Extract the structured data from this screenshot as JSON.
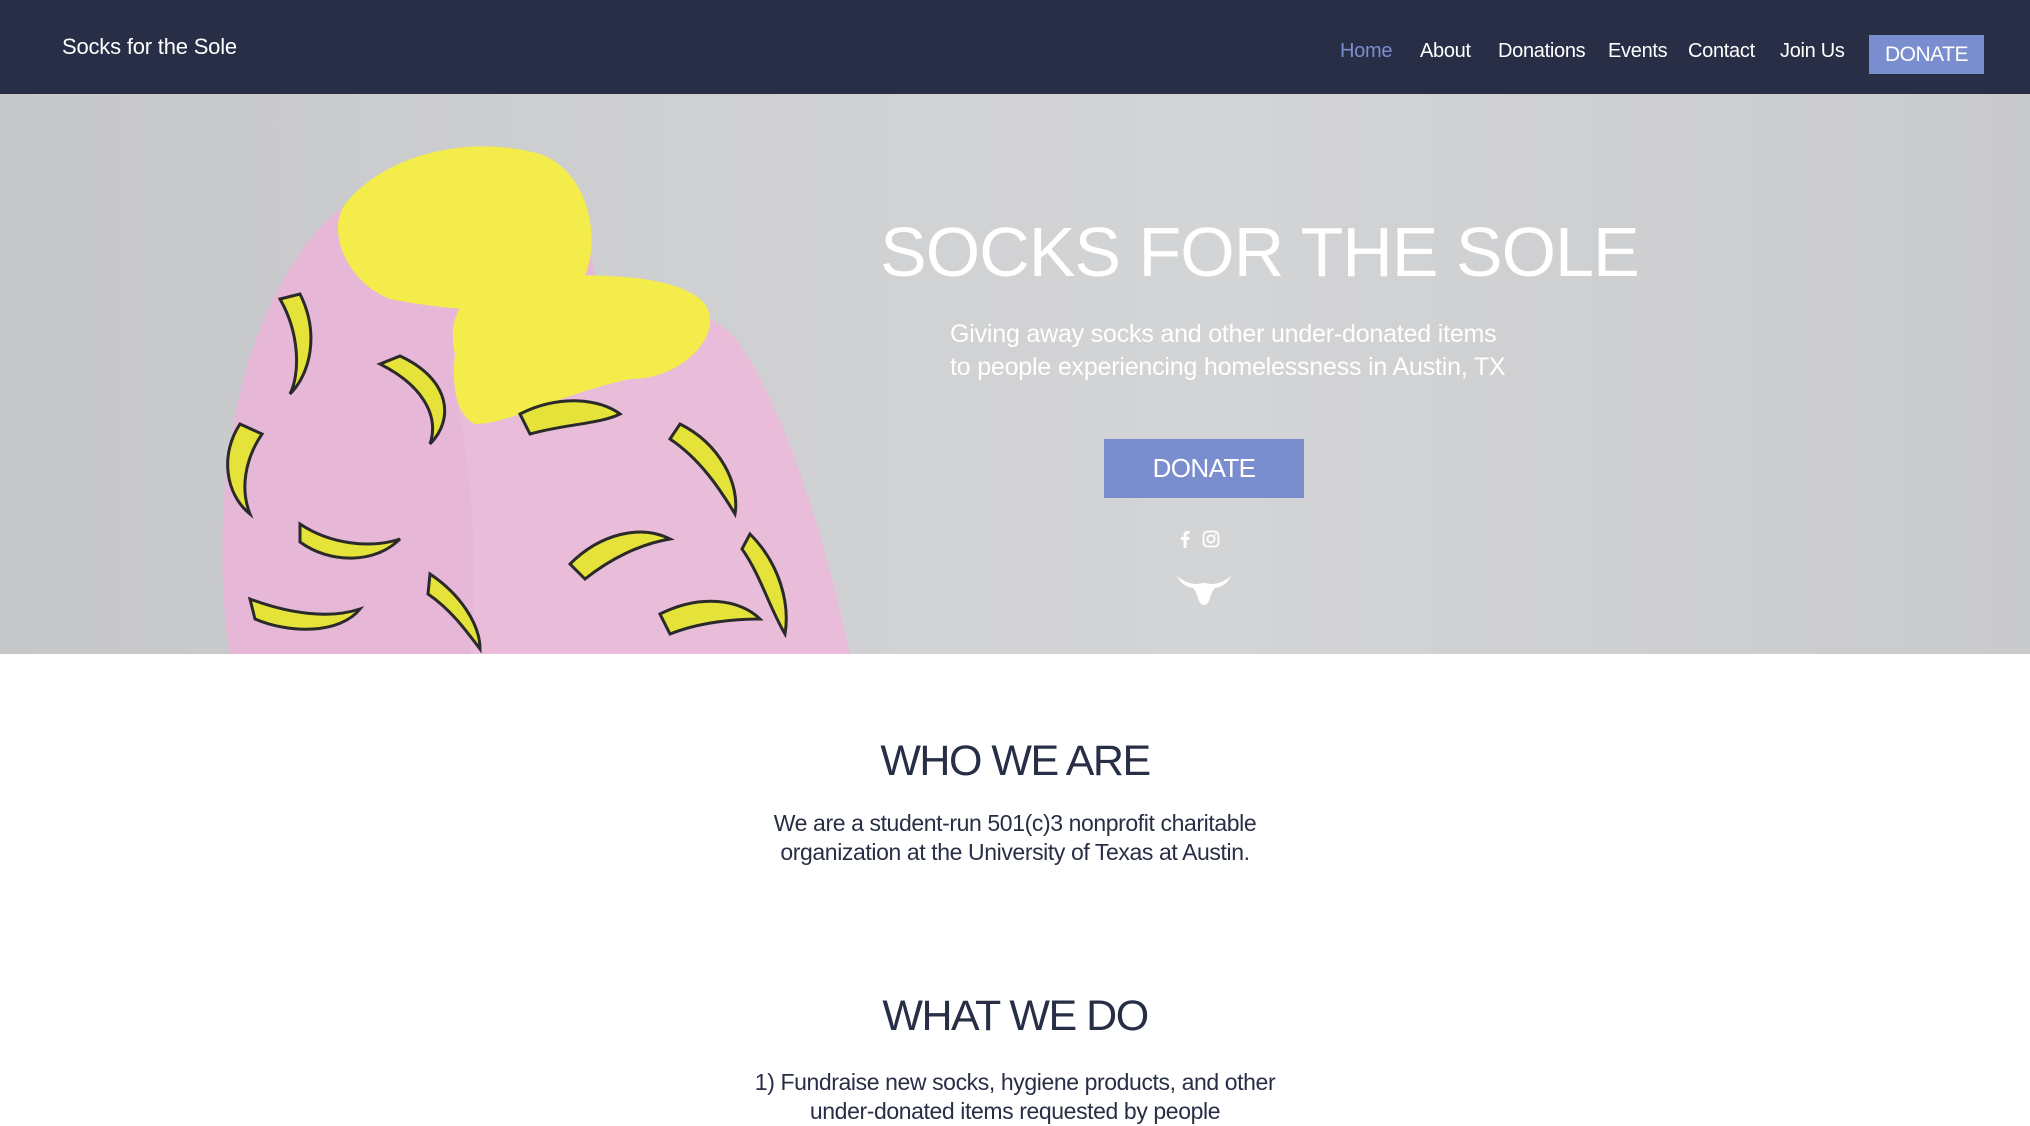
{
  "header": {
    "brand": "Socks for the Sole",
    "nav": [
      "Home",
      "About",
      "Donations",
      "Events",
      "Contact",
      "Join Us"
    ],
    "active_nav": "Home",
    "donate_label": "DONATE"
  },
  "hero": {
    "title": "SOCKS FOR THE SOLE",
    "subtitle_line1": "Giving away socks and other under-donated items",
    "subtitle_line2": "to people experiencing homelessness in Austin, TX",
    "donate_label": "DONATE",
    "social_icons": [
      "facebook-icon",
      "instagram-icon"
    ],
    "logo_icon": "longhorn-icon"
  },
  "who_we_are": {
    "title": "WHO WE ARE",
    "line1": "We are a student-run 501(c)3 nonprofit charitable",
    "line2": "organization at the University of Texas at Austin."
  },
  "what_we_do": {
    "title": "WHAT WE DO",
    "line1": "1) Fundraise new socks, hygiene products, and other",
    "line2": "under-donated items requested by people"
  },
  "colors": {
    "header_bg": "#282e45",
    "accent": "#7a8ecf",
    "text_dark": "#282e45",
    "sock_pink": "#e7b7d7",
    "sock_yellow": "#f3ec4a"
  }
}
